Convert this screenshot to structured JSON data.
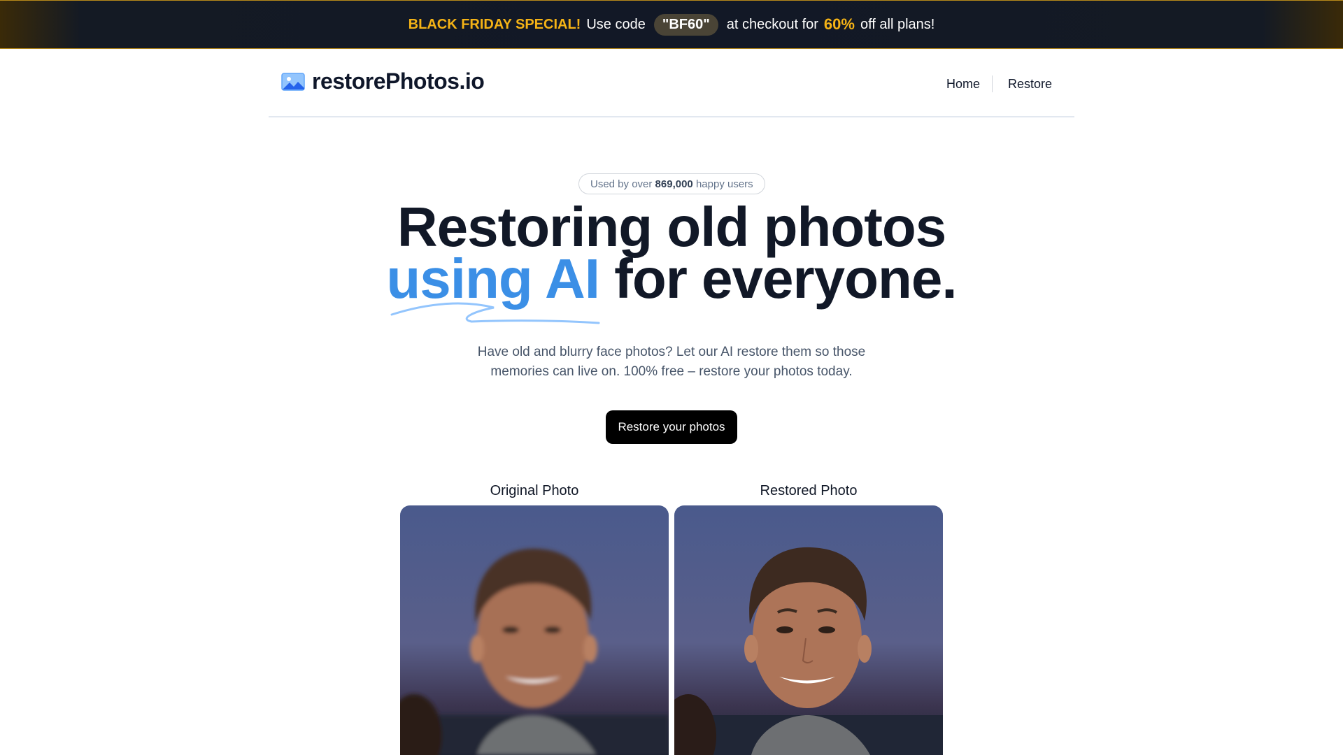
{
  "promo": {
    "highlight": "BLACK FRIDAY SPECIAL!",
    "use_code": "Use code",
    "code": "\"BF60\"",
    "at_checkout": "at checkout for",
    "percent": "60%",
    "rest": "off all plans!"
  },
  "header": {
    "logo_text": "restorePhotos.io",
    "nav": {
      "home": "Home",
      "restore": "Restore"
    }
  },
  "hero": {
    "badge_prefix": "Used by over",
    "badge_count": "869,000",
    "badge_suffix": "happy users",
    "title_line1": "Restoring old photos",
    "title_blue": "using AI",
    "title_rest": " for everyone.",
    "subtitle_line1": "Have old and blurry face photos? Let our AI restore them so those",
    "subtitle_line2": "memories can live on. 100% free – restore your photos today.",
    "cta": "Restore your photos"
  },
  "comparison": {
    "original_label": "Original Photo",
    "restored_label": "Restored Photo"
  },
  "colors": {
    "accent_blue": "#3b8fe6",
    "promo_gold": "#f5b316",
    "banner_bg": "#121826"
  }
}
